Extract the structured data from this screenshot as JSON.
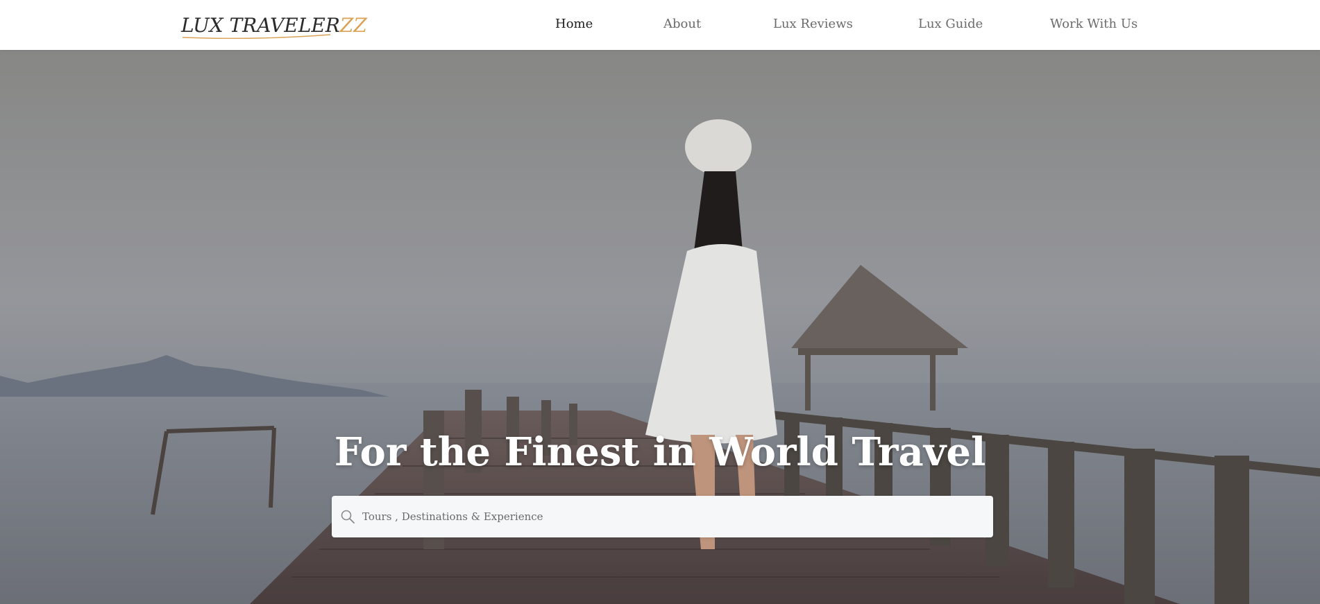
{
  "brand": {
    "logo_main": "LUX TRAVELER",
    "logo_accent": "ZZ",
    "accent_color": "#d9a255"
  },
  "nav": {
    "items": [
      {
        "label": "Home",
        "active": true
      },
      {
        "label": "About",
        "active": false
      },
      {
        "label": "Lux Reviews",
        "active": false
      },
      {
        "label": "Lux Guide",
        "active": false
      },
      {
        "label": "Work With Us",
        "active": false
      }
    ]
  },
  "hero": {
    "title": "For the Finest in World Travel",
    "search": {
      "placeholder": "Tours , Destinations & Experience",
      "value": "",
      "icon": "search-icon"
    }
  }
}
